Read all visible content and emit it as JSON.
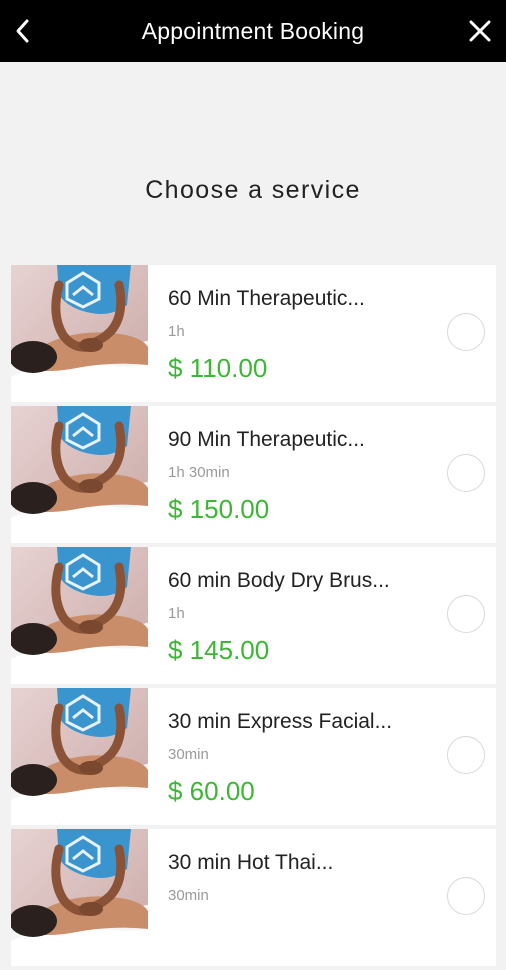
{
  "header": {
    "title": "Appointment Booking",
    "back_icon": "chevron-left-icon",
    "close_icon": "close-icon"
  },
  "heading": "Choose a service",
  "colors": {
    "price": "#3db635",
    "header_bg": "#000000",
    "background": "#f2f2f2"
  },
  "services": [
    {
      "name": "60 Min Therapeutic...",
      "duration": "1h",
      "price": "$ 110.00",
      "image": "massage-photo"
    },
    {
      "name": "90 Min Therapeutic...",
      "duration": "1h 30min",
      "price": "$ 150.00",
      "image": "massage-photo"
    },
    {
      "name": "60 min Body Dry Brus...",
      "duration": "1h",
      "price": "$ 145.00",
      "image": "massage-photo"
    },
    {
      "name": "30 min Express Facial...",
      "duration": "30min",
      "price": "$ 60.00",
      "image": "massage-photo"
    },
    {
      "name": "30 min Hot Thai...",
      "duration": "30min",
      "price": "",
      "image": "massage-photo"
    }
  ]
}
